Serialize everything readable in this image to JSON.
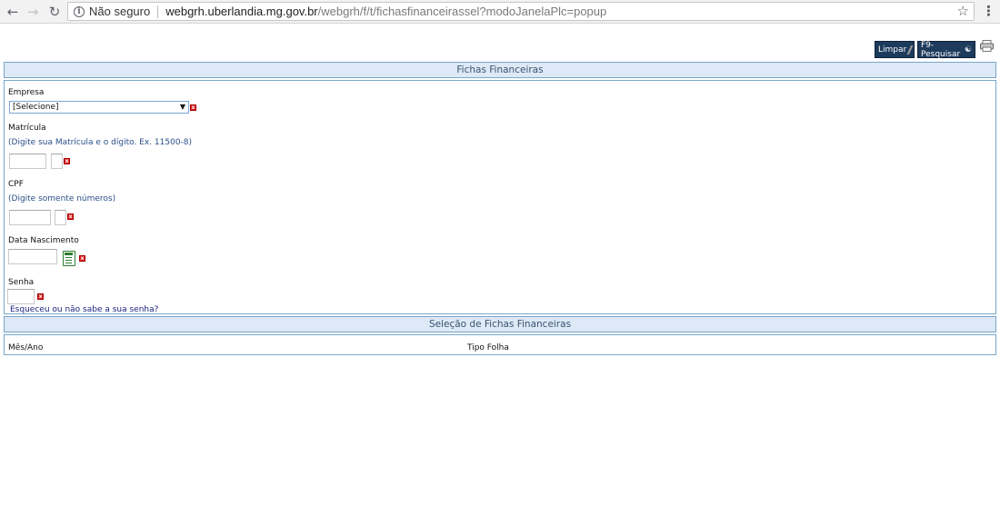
{
  "browser": {
    "security_label": "Não seguro",
    "url_host": "webgrh.uberlandia.mg.gov.br",
    "url_path": "/webgrh/f/t/fichasfinanceirassel?modoJanelaPlc=popup"
  },
  "toolbar": {
    "limpar_label": "Limpar",
    "pesquisar_label": "F9-Pesquisar"
  },
  "form": {
    "title": "Fichas Financeiras",
    "empresa_label": "Empresa",
    "empresa_selected": "[Selecione]",
    "matricula_label": "Matrícula",
    "matricula_hint": "(Digite sua Matrícula e o dígito. Ex. 11500-8)",
    "cpf_label": "CPF",
    "cpf_hint": "(Digite somente números)",
    "nascimento_label": "Data Nascimento",
    "senha_label": "Senha",
    "forgot_link": "Esqueceu ou não sabe a sua senha?"
  },
  "selection": {
    "title": "Seleção de Fichas Financeiras",
    "columns": [
      "Mês/Ano",
      "Tipo Folha"
    ]
  }
}
